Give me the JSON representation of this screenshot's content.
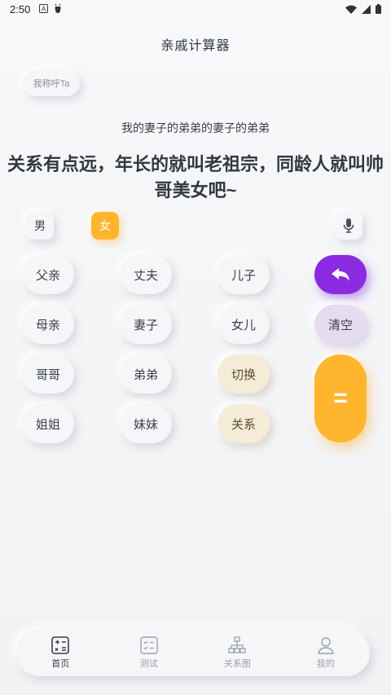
{
  "status": {
    "time": "2:50"
  },
  "header": {
    "title": "亲戚计算器"
  },
  "call_ta_label": "我称呼Ta",
  "expression": "我的妻子的弟弟的妻子的弟弟",
  "result": "关系有点远，年长的就叫老祖宗，同龄人就叫帅哥美女吧~",
  "gender": {
    "male": "男",
    "female": "女",
    "selected": "女"
  },
  "keys": {
    "father": "父亲",
    "husband": "丈夫",
    "son": "儿子",
    "mother": "母亲",
    "wife": "妻子",
    "daughter": "女儿",
    "clear": "清空",
    "elder_brother": "哥哥",
    "younger_brother": "弟弟",
    "switch": "切换",
    "elder_sister": "姐姐",
    "younger_sister": "妹妹",
    "relation": "关系",
    "equals": "="
  },
  "tabs": [
    {
      "label": "首页",
      "icon": "calculator-icon",
      "active": true
    },
    {
      "label": "测试",
      "icon": "checklist-icon",
      "active": false
    },
    {
      "label": "关系图",
      "icon": "tree-icon",
      "active": false
    },
    {
      "label": "我的",
      "icon": "person-icon",
      "active": false
    }
  ],
  "colors": {
    "accent": "#ffb52e",
    "purple": "#8a2be2",
    "lilac": "#e6dcf0",
    "cream": "#f4ecd8"
  }
}
